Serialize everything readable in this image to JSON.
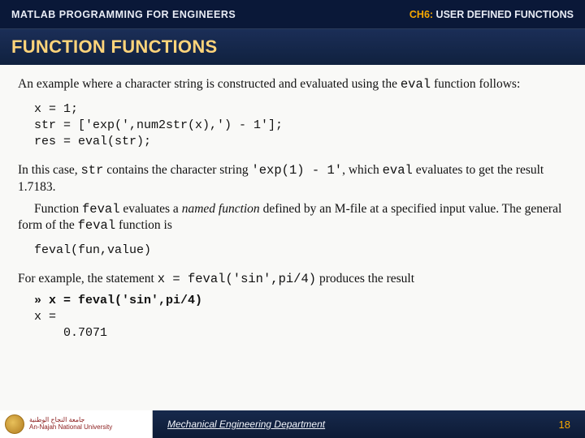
{
  "header": {
    "left": "MATLAB PROGRAMMING FOR ENGINEERS",
    "right_ch": "CH6:",
    "right_rest": " USER DEFINED FUNCTIONS"
  },
  "title": "FUNCTION FUNCTIONS",
  "body": {
    "p1_a": "An example where a character string is constructed and evaluated using the ",
    "p1_code": "eval",
    "p1_b": " function follows:",
    "code1": "x = 1;\nstr = ['exp(',num2str(x),') - 1'];\nres = eval(str);",
    "p2_a": "In this case, ",
    "p2_code1": "str",
    "p2_b": " contains the character string ",
    "p2_code2": "'exp(1) - 1'",
    "p2_c": ", which ",
    "p2_code3": "eval",
    "p2_d": " evaluates to get the result 1.7183.",
    "p3_a": "Function ",
    "p3_code1": "feval",
    "p3_b": " evaluates a ",
    "p3_em": "named function",
    "p3_c": " defined by an M-file at a specified input value. The general form of the ",
    "p3_code2": "feval",
    "p3_d": " function is",
    "code2": "feval(fun,value)",
    "p4_a": "For example, the statement ",
    "p4_code1": "x = feval('sin',pi/4)",
    "p4_b": " produces the result",
    "result_cmd": "» x = feval('sin',pi/4)",
    "result_out": "x =\n    0.7071"
  },
  "footer": {
    "uni_ar": "جامعة النجاح الوطنية",
    "uni_en": "An-Najah National University",
    "dept": "Mechanical Engineering Department",
    "page": "18"
  }
}
